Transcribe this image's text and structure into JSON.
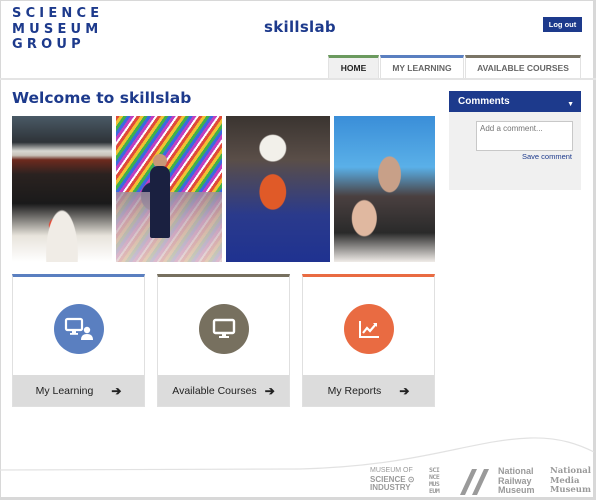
{
  "header": {
    "logo_lines": [
      "SCIENCE",
      "MUSEUM",
      "GROUP"
    ],
    "app_title": "skillslab",
    "logout_label": "Log out"
  },
  "tabs": [
    {
      "label": "HOME",
      "active": true,
      "color": "#6b9a5e"
    },
    {
      "label": "MY LEARNING",
      "active": false,
      "color": "#5a7fc0"
    },
    {
      "label": "AVAILABLE COURSES",
      "active": false,
      "color": "#7a7566"
    }
  ],
  "main": {
    "heading": "Welcome to skillslab",
    "photos": [
      {
        "name": "gala-dinner-photo"
      },
      {
        "name": "light-installation-photo"
      },
      {
        "name": "astronaut-schoolchildren-photo"
      },
      {
        "name": "interactive-exhibit-photo"
      }
    ],
    "tiles": [
      {
        "label": "My Learning",
        "icon": "monitor-user-icon",
        "color": "#5a7fc0",
        "arrow": "➔"
      },
      {
        "label": "Available Courses",
        "icon": "monitor-icon",
        "color": "#77705f",
        "arrow": "➔"
      },
      {
        "label": "My Reports",
        "icon": "line-chart-icon",
        "color": "#e96b42",
        "arrow": "➔"
      }
    ]
  },
  "comments": {
    "title": "Comments",
    "caret": "▼",
    "placeholder": "Add a comment...",
    "save_label": "Save comment"
  },
  "footer": {
    "msi": [
      "MUSEUM OF",
      "SCIENCE ⊙",
      "INDUSTRY"
    ],
    "science_museum": [
      "SCI",
      "NCE",
      "MUS",
      "EUM"
    ],
    "nrm": [
      "National",
      "Railway",
      "Museum"
    ],
    "nmm": [
      "National",
      "Media",
      "Museum"
    ]
  },
  "colors": {
    "brand": "#1d3a8c"
  }
}
